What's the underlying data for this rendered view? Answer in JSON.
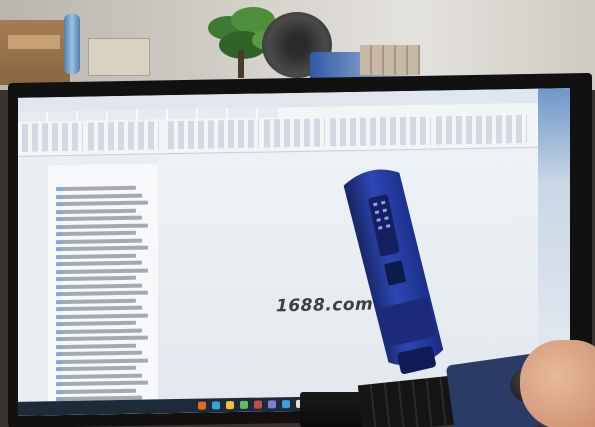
{
  "watermark": {
    "text": "1688.com"
  },
  "colors": {
    "device_body": "#2d46b4",
    "device_shadow": "#16245f",
    "device_base": "#1b2b7a",
    "screen_bg": "#e9eef3",
    "desk": "#3a3430"
  },
  "icons": [
    "plant-icon",
    "fan-icon",
    "mouse-icon"
  ]
}
